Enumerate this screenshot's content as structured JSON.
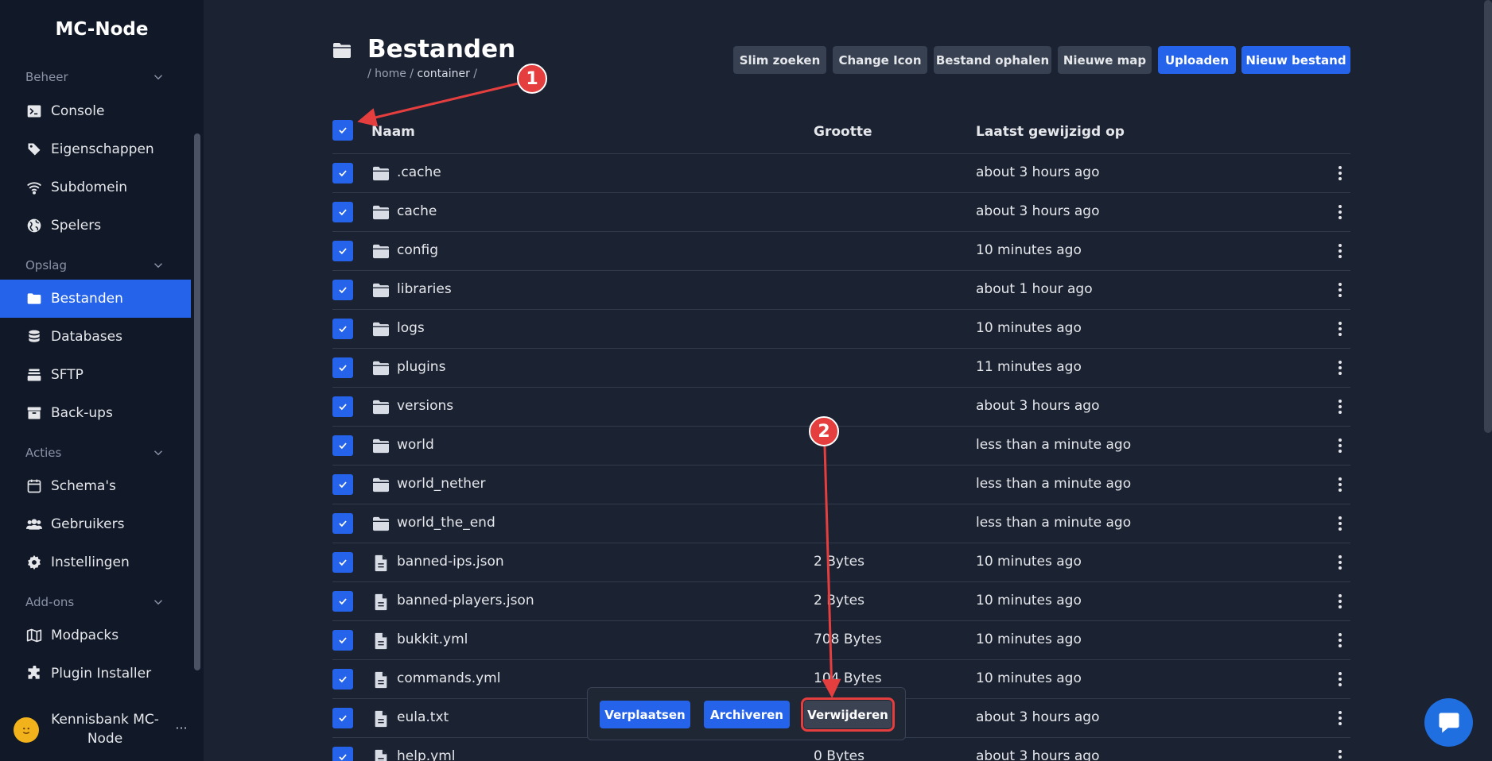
{
  "brand": "MC-Node",
  "sidebar": {
    "sections": [
      {
        "label": "Beheer",
        "items": [
          {
            "label": "Console",
            "icon": "terminal-icon"
          },
          {
            "label": "Eigenschappen",
            "icon": "tag-icon"
          },
          {
            "label": "Subdomein",
            "icon": "wifi-icon"
          },
          {
            "label": "Spelers",
            "icon": "globe-icon"
          }
        ]
      },
      {
        "label": "Opslag",
        "items": [
          {
            "label": "Bestanden",
            "icon": "folder-icon",
            "active": true
          },
          {
            "label": "Databases",
            "icon": "database-icon"
          },
          {
            "label": "SFTP",
            "icon": "stack-icon"
          },
          {
            "label": "Back-ups",
            "icon": "archive-icon"
          }
        ]
      },
      {
        "label": "Acties",
        "items": [
          {
            "label": "Schema's",
            "icon": "calendar-icon"
          },
          {
            "label": "Gebruikers",
            "icon": "users-icon"
          },
          {
            "label": "Instellingen",
            "icon": "gear-icon"
          }
        ]
      },
      {
        "label": "Add-ons",
        "items": [
          {
            "label": "Modpacks",
            "icon": "map-icon"
          },
          {
            "label": "Plugin Installer",
            "icon": "puzzle-icon"
          }
        ]
      }
    ],
    "user": {
      "name": "Kennisbank MC-Node",
      "more": "···"
    }
  },
  "header": {
    "title": "Bestanden",
    "breadcrumb_prefix": "/ home / ",
    "breadcrumb_current": "container",
    "breadcrumb_suffix": " /"
  },
  "toolbar": {
    "smart_search": "Slim zoeken",
    "change_icon": "Change Icon",
    "fetch_file": "Bestand ophalen",
    "new_folder": "Nieuwe map",
    "upload": "Uploaden",
    "new_file": "Nieuw bestand"
  },
  "table": {
    "columns": {
      "name": "Naam",
      "size": "Grootte",
      "modified": "Laatst gewijzigd op"
    },
    "rows": [
      {
        "name": ".cache",
        "type": "folder",
        "size": "",
        "modified": "about 3 hours ago"
      },
      {
        "name": "cache",
        "type": "folder",
        "size": "",
        "modified": "about 3 hours ago"
      },
      {
        "name": "config",
        "type": "folder",
        "size": "",
        "modified": "10 minutes ago"
      },
      {
        "name": "libraries",
        "type": "folder",
        "size": "",
        "modified": "about 1 hour ago"
      },
      {
        "name": "logs",
        "type": "folder",
        "size": "",
        "modified": "10 minutes ago"
      },
      {
        "name": "plugins",
        "type": "folder",
        "size": "",
        "modified": "11 minutes ago"
      },
      {
        "name": "versions",
        "type": "folder",
        "size": "",
        "modified": "about 3 hours ago"
      },
      {
        "name": "world",
        "type": "folder",
        "size": "",
        "modified": "less than a minute ago"
      },
      {
        "name": "world_nether",
        "type": "folder",
        "size": "",
        "modified": "less than a minute ago"
      },
      {
        "name": "world_the_end",
        "type": "folder",
        "size": "",
        "modified": "less than a minute ago"
      },
      {
        "name": "banned-ips.json",
        "type": "file",
        "size": "2 Bytes",
        "modified": "10 minutes ago"
      },
      {
        "name": "banned-players.json",
        "type": "file",
        "size": "2 Bytes",
        "modified": "10 minutes ago"
      },
      {
        "name": "bukkit.yml",
        "type": "file",
        "size": "708 Bytes",
        "modified": "10 minutes ago"
      },
      {
        "name": "commands.yml",
        "type": "file",
        "size": "104 Bytes",
        "modified": "10 minutes ago"
      },
      {
        "name": "eula.txt",
        "type": "file",
        "size": "",
        "modified": "about 3 hours ago"
      },
      {
        "name": "help.yml",
        "type": "file",
        "size": "0 Bytes",
        "modified": "about 3 hours ago"
      }
    ]
  },
  "action_bar": {
    "move": "Verplaatsen",
    "archive": "Archiveren",
    "delete": "Verwijderen"
  },
  "annotations": {
    "step1": "1",
    "step2": "2",
    "color": "#e53e3e"
  },
  "colors": {
    "accent": "#2563eb",
    "sidebar_bg": "#111827",
    "page_bg": "#1b2232"
  }
}
